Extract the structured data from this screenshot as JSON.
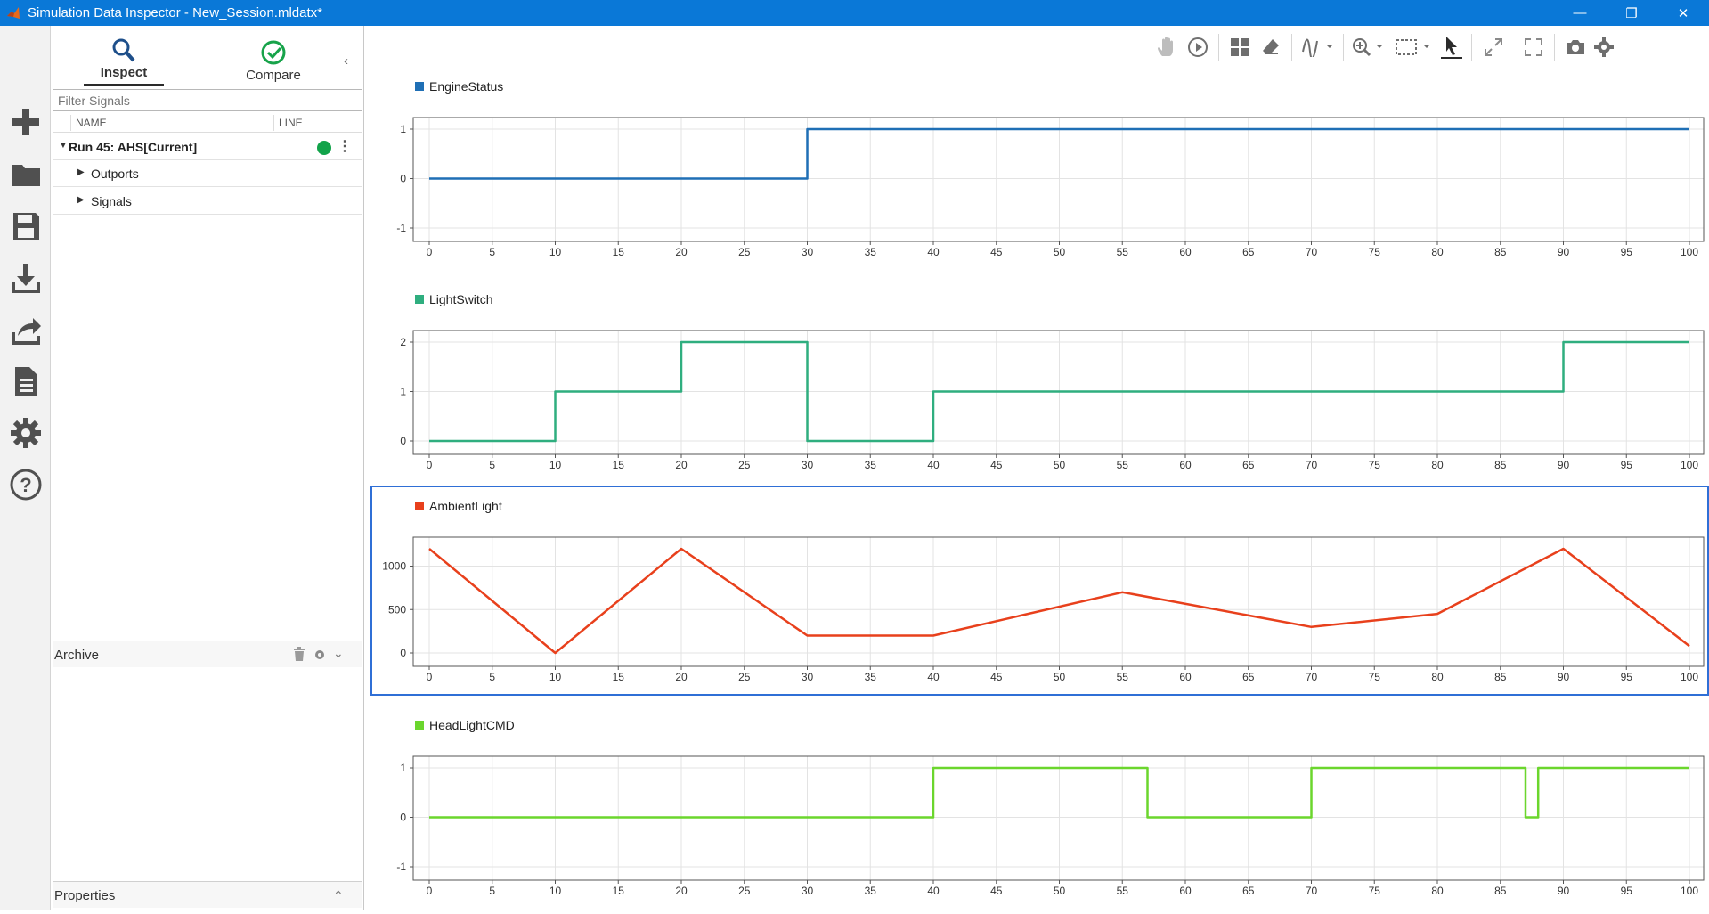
{
  "window": {
    "title": "Simulation Data Inspector - New_Session.mldatx*",
    "controls": [
      "—",
      "❐",
      "✕"
    ]
  },
  "rail": {
    "items": [
      "new-icon",
      "open-icon",
      "save-icon",
      "import-icon",
      "export-icon",
      "report-icon",
      "settings-icon",
      "help-icon"
    ]
  },
  "browser": {
    "tabs": {
      "inspect": "Inspect",
      "compare": "Compare"
    },
    "filter_placeholder": "Filter Signals",
    "columns": {
      "name": "NAME",
      "line": "LINE"
    },
    "run": {
      "label": "Run 45: AHS[Current]",
      "color": "#12a34a"
    },
    "children": [
      "Outports",
      "Signals"
    ],
    "archive_label": "Archive",
    "properties_label": "Properties"
  },
  "chart_data": [
    {
      "type": "line",
      "series": [
        {
          "name": "EngineStatus",
          "color": "#1f6fb5",
          "points": [
            [
              0,
              0
            ],
            [
              30,
              0
            ],
            [
              30,
              1
            ],
            [
              100,
              1
            ]
          ]
        }
      ],
      "xlim": [
        0,
        100
      ],
      "ylim": [
        -1,
        1
      ],
      "yticks": [
        -1,
        0,
        1
      ],
      "xticks": [
        0,
        5,
        10,
        15,
        20,
        25,
        30,
        35,
        40,
        45,
        50,
        55,
        60,
        65,
        70,
        75,
        80,
        85,
        90,
        95,
        100
      ],
      "grid": true,
      "legend": "top-left"
    },
    {
      "type": "line",
      "series": [
        {
          "name": "LightSwitch",
          "color": "#2fae7f",
          "points": [
            [
              0,
              0
            ],
            [
              10,
              0
            ],
            [
              10,
              1
            ],
            [
              20,
              1
            ],
            [
              20,
              2
            ],
            [
              30,
              2
            ],
            [
              30,
              0
            ],
            [
              40,
              0
            ],
            [
              40,
              1
            ],
            [
              90,
              1
            ],
            [
              90,
              2
            ],
            [
              100,
              2
            ]
          ]
        }
      ],
      "xlim": [
        0,
        100
      ],
      "ylim": [
        0,
        2
      ],
      "yticks": [
        0,
        1,
        2
      ],
      "xticks": [
        0,
        5,
        10,
        15,
        20,
        25,
        30,
        35,
        40,
        45,
        50,
        55,
        60,
        65,
        70,
        75,
        80,
        85,
        90,
        95,
        100
      ],
      "grid": true,
      "legend": "top-left"
    },
    {
      "type": "line",
      "series": [
        {
          "name": "AmbientLight",
          "color": "#e8401c",
          "points": [
            [
              0,
              1200
            ],
            [
              10,
              0
            ],
            [
              20,
              1200
            ],
            [
              30,
              200
            ],
            [
              40,
              200
            ],
            [
              55,
              700
            ],
            [
              70,
              300
            ],
            [
              80,
              450
            ],
            [
              90,
              1200
            ],
            [
              100,
              80
            ]
          ]
        }
      ],
      "xlim": [
        0,
        100
      ],
      "ylim": [
        0,
        1200
      ],
      "yticks": [
        0,
        500,
        1000
      ],
      "xticks": [
        0,
        5,
        10,
        15,
        20,
        25,
        30,
        35,
        40,
        45,
        50,
        55,
        60,
        65,
        70,
        75,
        80,
        85,
        90,
        95,
        100
      ],
      "grid": true,
      "legend": "top-left",
      "selected": true
    },
    {
      "type": "line",
      "series": [
        {
          "name": "HeadLightCMD",
          "color": "#6bd62d",
          "points": [
            [
              0,
              0
            ],
            [
              40,
              0
            ],
            [
              40,
              1
            ],
            [
              57,
              1
            ],
            [
              57,
              0
            ],
            [
              70,
              0
            ],
            [
              70,
              1
            ],
            [
              87,
              1
            ],
            [
              87,
              0
            ],
            [
              88,
              0
            ],
            [
              88,
              1
            ],
            [
              100,
              1
            ]
          ]
        }
      ],
      "xlim": [
        0,
        100
      ],
      "ylim": [
        -1,
        1
      ],
      "yticks": [
        -1,
        0,
        1
      ],
      "xticks": [
        0,
        5,
        10,
        15,
        20,
        25,
        30,
        35,
        40,
        45,
        50,
        55,
        60,
        65,
        70,
        75,
        80,
        85,
        90,
        95,
        100
      ],
      "grid": true,
      "legend": "top-left"
    }
  ]
}
